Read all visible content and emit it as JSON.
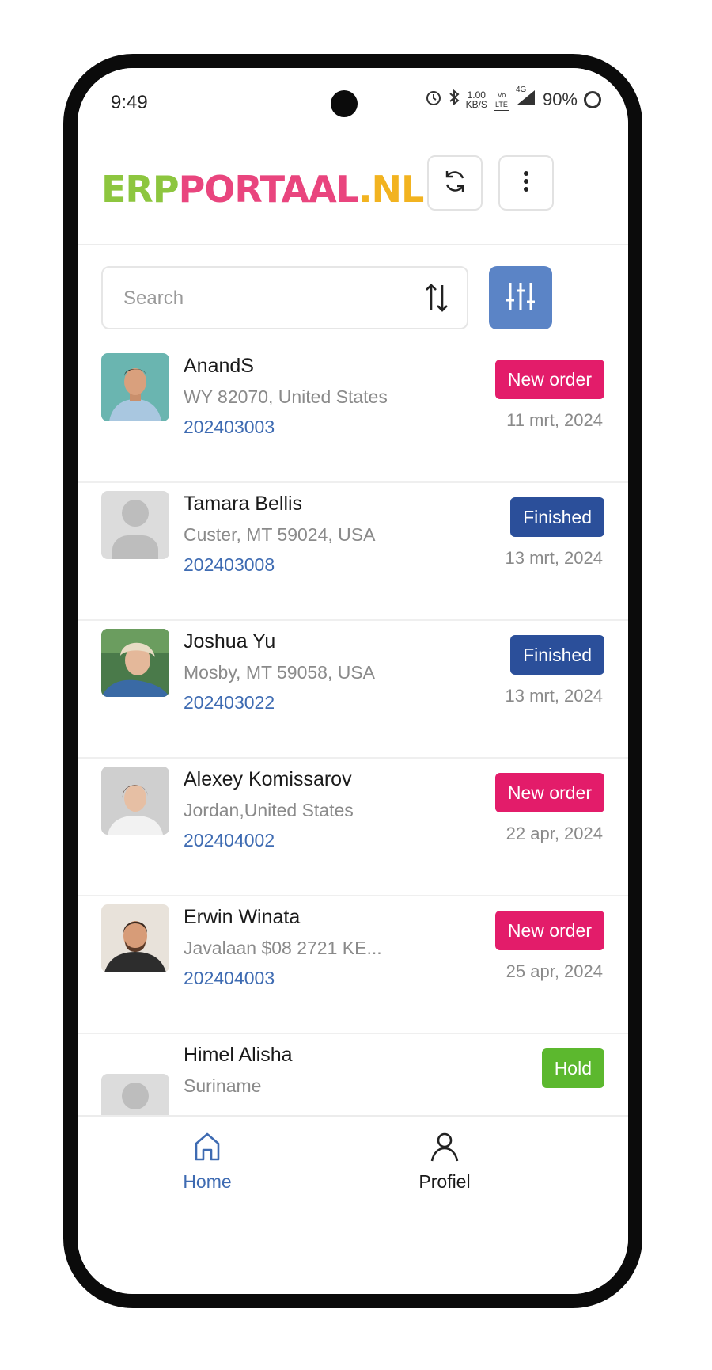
{
  "status_bar": {
    "time": "9:49",
    "net_speed_value": "1.00",
    "net_speed_unit": "KB/S",
    "volte": "Vo LTE",
    "network": "4G",
    "battery": "90%"
  },
  "header": {
    "logo_part1": "ERP",
    "logo_part2": "PORTAAL",
    "logo_part3": ".NL",
    "colors": {
      "green": "#8dc63f",
      "pink": "#e9457e",
      "yellow": "#f2b320"
    }
  },
  "search": {
    "placeholder": "Search"
  },
  "orders": [
    {
      "name": "AnandS",
      "address": "WY 82070, United States",
      "order_number": "202403003",
      "status": "New order",
      "status_type": "neworder",
      "date": "11 mrt, 2024",
      "avatar": "photo"
    },
    {
      "name": "Tamara Bellis",
      "address": "Custer, MT 59024, USA",
      "order_number": "202403008",
      "status": "Finished",
      "status_type": "finished",
      "date": "13 mrt, 2024",
      "avatar": "placeholder"
    },
    {
      "name": "Joshua Yu",
      "address": "Mosby, MT 59058, USA",
      "order_number": "202403022",
      "status": "Finished",
      "status_type": "finished",
      "date": "13 mrt, 2024",
      "avatar": "photo"
    },
    {
      "name": "Alexey Komissarov",
      "address": "Jordan,United States",
      "order_number": "202404002",
      "status": "New order",
      "status_type": "neworder",
      "date": "22 apr, 2024",
      "avatar": "photo"
    },
    {
      "name": "Erwin Winata",
      "address": "Javalaan $08 2721 KE...",
      "order_number": "202404003",
      "status": "New order",
      "status_type": "neworder",
      "date": "25 apr, 2024",
      "avatar": "photo"
    },
    {
      "name": "Himel Alisha",
      "address": "Suriname",
      "order_number": "",
      "status": "Hold",
      "status_type": "hold",
      "date": "",
      "avatar": "placeholder"
    }
  ],
  "status_colors": {
    "neworder": "#e31c6a",
    "finished": "#2b4f9a",
    "hold": "#5cb82e",
    "accent": "#5b84c6",
    "link": "#3e6bb2"
  },
  "bottom_nav": {
    "home_label": "Home",
    "profile_label": "Profiel"
  }
}
